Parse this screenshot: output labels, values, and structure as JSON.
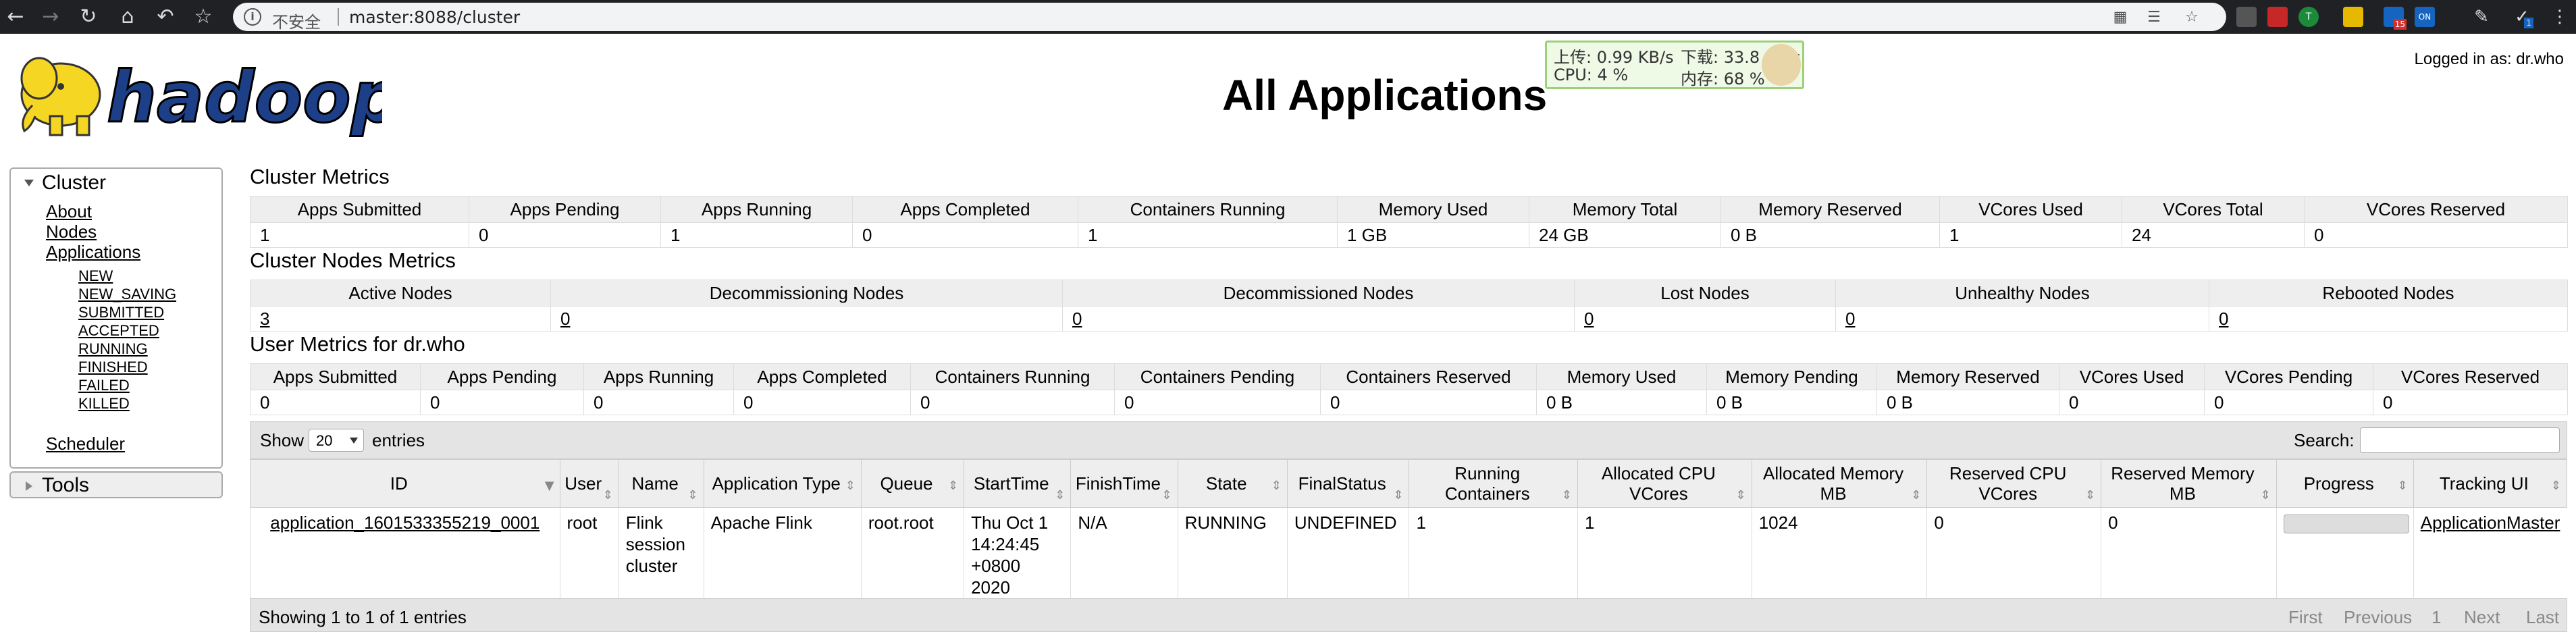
{
  "browser": {
    "insecure_label": "不安全",
    "url": "master:8088/cluster"
  },
  "netmon": {
    "upload": "上传: 0.99 KB/s",
    "download": "下载: 33.8 KB/s",
    "cpu": "CPU: 4 %",
    "memory": "内存: 68 %"
  },
  "extensions": {
    "badge1": "15",
    "badge2": "ON",
    "badge3": "1"
  },
  "header": {
    "logo_text": "hadoop",
    "title": "All Applications",
    "logged_in": "Logged in as: dr.who"
  },
  "sidebar": {
    "cluster_label": "Cluster",
    "links": [
      "About",
      "Nodes",
      "Applications"
    ],
    "app_states": [
      "NEW",
      "NEW_SAVING",
      "SUBMITTED",
      "ACCEPTED",
      "RUNNING",
      "FINISHED",
      "FAILED",
      "KILLED"
    ],
    "scheduler": "Scheduler",
    "tools_label": "Tools"
  },
  "cluster_metrics": {
    "title": "Cluster Metrics",
    "headers": [
      "Apps Submitted",
      "Apps Pending",
      "Apps Running",
      "Apps Completed",
      "Containers Running",
      "Memory Used",
      "Memory Total",
      "Memory Reserved",
      "VCores Used",
      "VCores Total",
      "VCores Reserved"
    ],
    "values": [
      "1",
      "0",
      "1",
      "0",
      "1",
      "1 GB",
      "24 GB",
      "0 B",
      "1",
      "24",
      "0"
    ]
  },
  "node_metrics": {
    "title": "Cluster Nodes Metrics",
    "headers": [
      "Active Nodes",
      "Decommissioning Nodes",
      "Decommissioned Nodes",
      "Lost Nodes",
      "Unhealthy Nodes",
      "Rebooted Nodes"
    ],
    "values": [
      "3",
      "0",
      "0",
      "0",
      "0",
      "0"
    ]
  },
  "user_metrics": {
    "title": "User Metrics for dr.who",
    "headers": [
      "Apps Submitted",
      "Apps Pending",
      "Apps Running",
      "Apps Completed",
      "Containers Running",
      "Containers Pending",
      "Containers Reserved",
      "Memory Used",
      "Memory Pending",
      "Memory Reserved",
      "VCores Used",
      "VCores Pending",
      "VCores Reserved"
    ],
    "values": [
      "0",
      "0",
      "0",
      "0",
      "0",
      "0",
      "0",
      "0 B",
      "0 B",
      "0 B",
      "0",
      "0",
      "0"
    ]
  },
  "apps_table": {
    "show_label": "Show",
    "page_size": "20",
    "entries_label": "entries",
    "search_label": "Search:",
    "search_value": "",
    "headers": [
      "ID",
      "User",
      "Name",
      "Application Type",
      "Queue",
      "StartTime",
      "FinishTime",
      "State",
      "FinalStatus",
      "Running Containers",
      "Allocated CPU VCores",
      "Allocated Memory MB",
      "Reserved CPU VCores",
      "Reserved Memory MB",
      "Progress",
      "Tracking UI"
    ],
    "rows": [
      {
        "id": "application_1601533355219_0001",
        "user": "root",
        "name": "Flink session cluster",
        "type": "Apache Flink",
        "queue": "root.root",
        "start": "Thu Oct 1 14:24:45 +0800 2020",
        "finish": "N/A",
        "state": "RUNNING",
        "final_status": "UNDEFINED",
        "running_containers": "1",
        "alloc_vcores": "1",
        "alloc_mem": "1024",
        "res_vcores": "0",
        "res_mem": "0",
        "progress": 0,
        "tracking": "ApplicationMaster"
      }
    ],
    "showing": "Showing 1 to 1 of 1 entries",
    "pager": {
      "first": "First",
      "previous": "Previous",
      "page": "1",
      "next": "Next",
      "last": "Last"
    }
  }
}
